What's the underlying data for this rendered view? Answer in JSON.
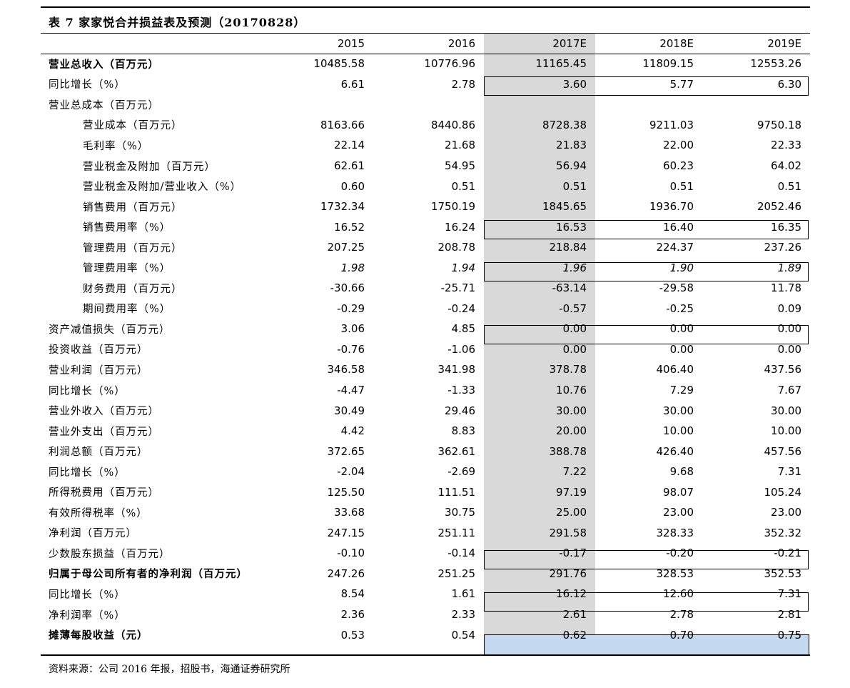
{
  "title": "表 7 家家悦合并损益表及预测（20170828）",
  "columns": [
    "2015",
    "2016",
    "2017E",
    "2018E",
    "2019E"
  ],
  "rows": [
    {
      "label": "营业总收入（百万元）",
      "indent": 0,
      "bold": true,
      "values": [
        "10485.58",
        "10776.96",
        "11165.45",
        "11809.15",
        "12553.26"
      ]
    },
    {
      "label": "同比增长（%）",
      "indent": 0,
      "values": [
        "6.61",
        "2.78",
        "3.60",
        "5.77",
        "6.30"
      ]
    },
    {
      "label": "营业总成本（百万元）",
      "indent": 0,
      "values": [
        "",
        "",
        "",
        "",
        ""
      ]
    },
    {
      "label": "营业成本（百万元）",
      "indent": 1,
      "values": [
        "8163.66",
        "8440.86",
        "8728.38",
        "9211.03",
        "9750.18"
      ]
    },
    {
      "label": "毛利率（%）",
      "indent": 1,
      "values": [
        "22.14",
        "21.68",
        "21.83",
        "22.00",
        "22.33"
      ]
    },
    {
      "label": "营业税金及附加（百万元）",
      "indent": 1,
      "values": [
        "62.61",
        "54.95",
        "56.94",
        "60.23",
        "64.02"
      ]
    },
    {
      "label": "营业税金及附加/营业收入（%）",
      "indent": 1,
      "values": [
        "0.60",
        "0.51",
        "0.51",
        "0.51",
        "0.51"
      ]
    },
    {
      "label": "销售费用（百万元）",
      "indent": 1,
      "values": [
        "1732.34",
        "1750.19",
        "1845.65",
        "1936.70",
        "2052.46"
      ]
    },
    {
      "label": "销售费用率（%）",
      "indent": 1,
      "values": [
        "16.52",
        "16.24",
        "16.53",
        "16.40",
        "16.35"
      ]
    },
    {
      "label": "管理费用（百万元）",
      "indent": 1,
      "values": [
        "207.25",
        "208.78",
        "218.84",
        "224.37",
        "237.26"
      ]
    },
    {
      "label": "管理费用率（%）",
      "indent": 1,
      "italic": true,
      "values": [
        "1.98",
        "1.94",
        "1.96",
        "1.90",
        "1.89"
      ]
    },
    {
      "label": "财务费用（百万元）",
      "indent": 1,
      "values": [
        "-30.66",
        "-25.71",
        "-63.14",
        "-29.58",
        "11.78"
      ]
    },
    {
      "label": "期间费用率（%）",
      "indent": 1,
      "values": [
        "-0.29",
        "-0.24",
        "-0.57",
        "-0.25",
        "0.09"
      ]
    },
    {
      "label": "资产减值损失（百万元）",
      "indent": 0,
      "values": [
        "3.06",
        "4.85",
        "0.00",
        "0.00",
        "0.00"
      ]
    },
    {
      "label": "投资收益（百万元）",
      "indent": 0,
      "values": [
        "-0.76",
        "-1.06",
        "0.00",
        "0.00",
        "0.00"
      ]
    },
    {
      "label": "营业利润（百万元）",
      "indent": 0,
      "values": [
        "346.58",
        "341.98",
        "378.78",
        "406.40",
        "437.56"
      ]
    },
    {
      "label": "同比增长（%）",
      "indent": 0,
      "values": [
        "-4.47",
        "-1.33",
        "10.76",
        "7.29",
        "7.67"
      ]
    },
    {
      "label": "营业外收入（百万元）",
      "indent": 0,
      "values": [
        "30.49",
        "29.46",
        "30.00",
        "30.00",
        "30.00"
      ]
    },
    {
      "label": "营业外支出（百万元）",
      "indent": 0,
      "values": [
        "4.42",
        "8.83",
        "20.00",
        "10.00",
        "10.00"
      ]
    },
    {
      "label": "利润总额（百万元）",
      "indent": 0,
      "values": [
        "372.65",
        "362.61",
        "388.78",
        "426.40",
        "457.56"
      ]
    },
    {
      "label": "同比增长（%）",
      "indent": 0,
      "values": [
        "-2.04",
        "-2.69",
        "7.22",
        "9.68",
        "7.31"
      ]
    },
    {
      "label": "所得税费用（百万元）",
      "indent": 0,
      "values": [
        "125.50",
        "111.51",
        "97.19",
        "98.07",
        "105.24"
      ]
    },
    {
      "label": "有效所得税率（%）",
      "indent": 0,
      "values": [
        "33.68",
        "30.75",
        "25.00",
        "23.00",
        "23.00"
      ]
    },
    {
      "label": "净利润（百万元）",
      "indent": 0,
      "values": [
        "247.15",
        "251.11",
        "291.58",
        "328.33",
        "352.32"
      ]
    },
    {
      "label": "少数股东损益（百万元）",
      "indent": 0,
      "values": [
        "-0.10",
        "-0.14",
        "-0.17",
        "-0.20",
        "-0.21"
      ]
    },
    {
      "label": "归属于母公司所有者的净利润（百万元）",
      "indent": 0,
      "bold": true,
      "values": [
        "247.26",
        "251.25",
        "291.76",
        "328.53",
        "352.53"
      ]
    },
    {
      "label": "同比增长（%）",
      "indent": 0,
      "values": [
        "8.54",
        "1.61",
        "16.12",
        "12.60",
        "7.31"
      ]
    },
    {
      "label": "净利润率（%）",
      "indent": 0,
      "values": [
        "2.36",
        "2.33",
        "2.61",
        "2.78",
        "2.81"
      ]
    },
    {
      "label": "摊薄每股收益（元）",
      "indent": 0,
      "bold": true,
      "values": [
        "0.53",
        "0.54",
        "0.62",
        "0.70",
        "0.75"
      ]
    }
  ],
  "source": "资料来源：公司 2016 年报，招股书，海通证券研究所",
  "colors": {
    "forecast_shade": "#d9d9d9",
    "eps_highlight": "#c5d9f1"
  }
}
